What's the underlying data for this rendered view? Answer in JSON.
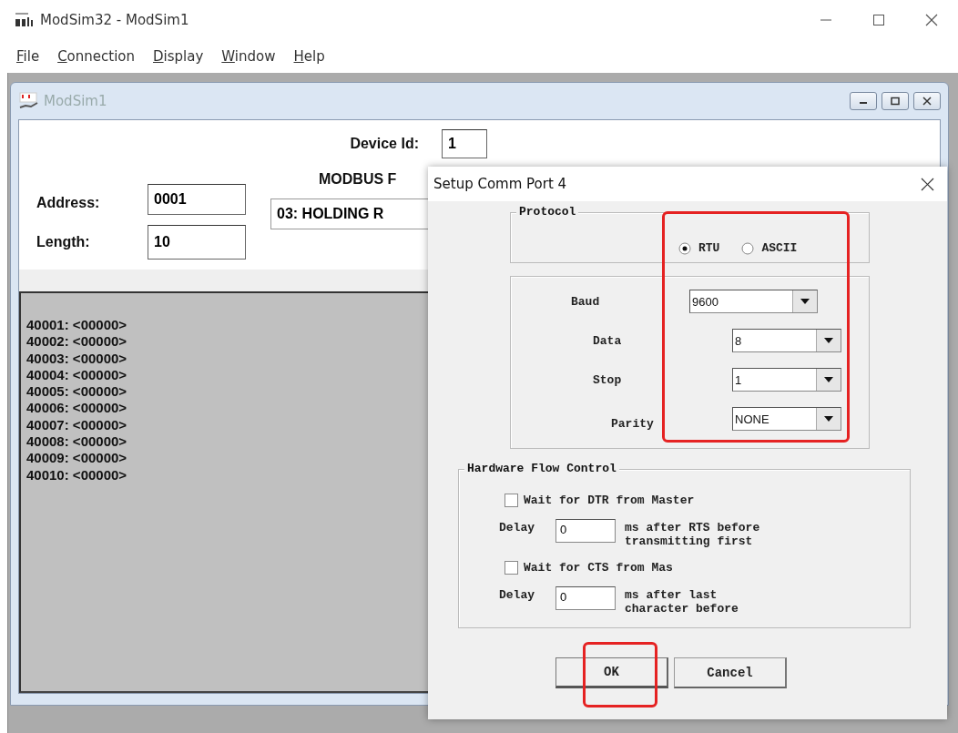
{
  "window": {
    "title": "ModSim32 - ModSim1"
  },
  "menu": [
    {
      "label": "File"
    },
    {
      "label": "Connection"
    },
    {
      "label": "Display"
    },
    {
      "label": "Window"
    },
    {
      "label": "Help"
    }
  ],
  "child": {
    "title": "ModSim1",
    "device_id": {
      "label": "Device Id:",
      "value": "1"
    },
    "address": {
      "label": "Address:",
      "value": "0001"
    },
    "length": {
      "label": "Length:",
      "value": "10"
    },
    "function": {
      "label": "MODBUS F",
      "value": "03: HOLDING R"
    },
    "registers": [
      "40001: <00000>",
      "40002: <00000>",
      "40003: <00000>",
      "40004: <00000>",
      "40005: <00000>",
      "40006: <00000>",
      "40007: <00000>",
      "40008: <00000>",
      "40009: <00000>",
      "40010: <00000>"
    ]
  },
  "dialog": {
    "title": "Setup Comm Port 4",
    "protocol": {
      "legend": "Protocol",
      "options": [
        {
          "label": "RTU",
          "selected": true
        },
        {
          "label": "ASCII",
          "selected": false
        }
      ]
    },
    "settings_highlighted": true,
    "settings": [
      {
        "label": "Baud",
        "value": "9600"
      },
      {
        "label": "Data",
        "value": "8"
      },
      {
        "label": "Stop",
        "value": "1"
      },
      {
        "label": "Parity",
        "value": "NONE"
      }
    ],
    "flow": {
      "legend": "Hardware Flow Control",
      "items": [
        {
          "kind": "checkbox",
          "label": "Wait for DTR from Master",
          "checked": false
        },
        {
          "kind": "delay",
          "label": "Delay",
          "value": "0",
          "note": "ms after RTS before transmitting first"
        },
        {
          "kind": "checkbox",
          "label": "Wait for CTS from Mas",
          "checked": false
        },
        {
          "kind": "delay",
          "label": "Delay",
          "value": "0",
          "note": "ms after last character before"
        }
      ]
    },
    "buttons": [
      {
        "label": "OK",
        "highlighted": true
      },
      {
        "label": "Cancel",
        "highlighted": false
      }
    ]
  }
}
